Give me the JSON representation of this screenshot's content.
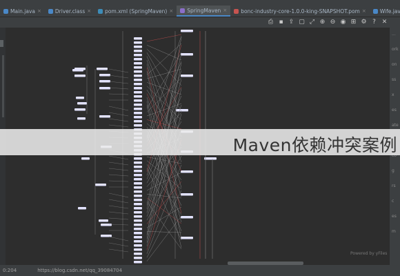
{
  "tabs": [
    {
      "label": "Main.java",
      "icon_color": "#4a88c7",
      "active": false
    },
    {
      "label": "Driver.class",
      "icon_color": "#4a88c7",
      "active": false
    },
    {
      "label": "pom.xml (SpringMaven)",
      "icon_color": "#3d8cb8",
      "active": false
    },
    {
      "label": "SpringMaven",
      "icon_color": "#8c6fc9",
      "active": true
    },
    {
      "label": "bonc-industry-core-1.0.0-king-SNAPSHOT.pom",
      "icon_color": "#c75450",
      "active": false
    },
    {
      "label": "Wife.java",
      "icon_color": "#4a88c7",
      "active": false
    }
  ],
  "toolbar_icons": [
    "print-icon",
    "save-icon",
    "export-icon",
    "fit-icon",
    "expand-icon",
    "zoom-in-icon",
    "zoom-out-icon",
    "show-icon",
    "layout-icon",
    "settings-icon",
    "help-icon",
    "close-icon"
  ],
  "banner": {
    "text": "Maven依赖冲突案例"
  },
  "status": {
    "coord": "0:204",
    "url": "https://blog.csdn.net/qq_39084704"
  },
  "watermark": "Powered by yFiles",
  "right_panel_snippets": [
    "...",
    "ork",
    "on",
    "ss",
    "x",
    "es",
    "ate",
    "v",
    "co",
    "g",
    "rs",
    "c",
    "es",
    "m"
  ],
  "colors": {
    "node": "#e3e3ff",
    "edge": "#8c8c8c",
    "conflict_edge": "#c44d4d",
    "accent": "#4a88c7"
  }
}
